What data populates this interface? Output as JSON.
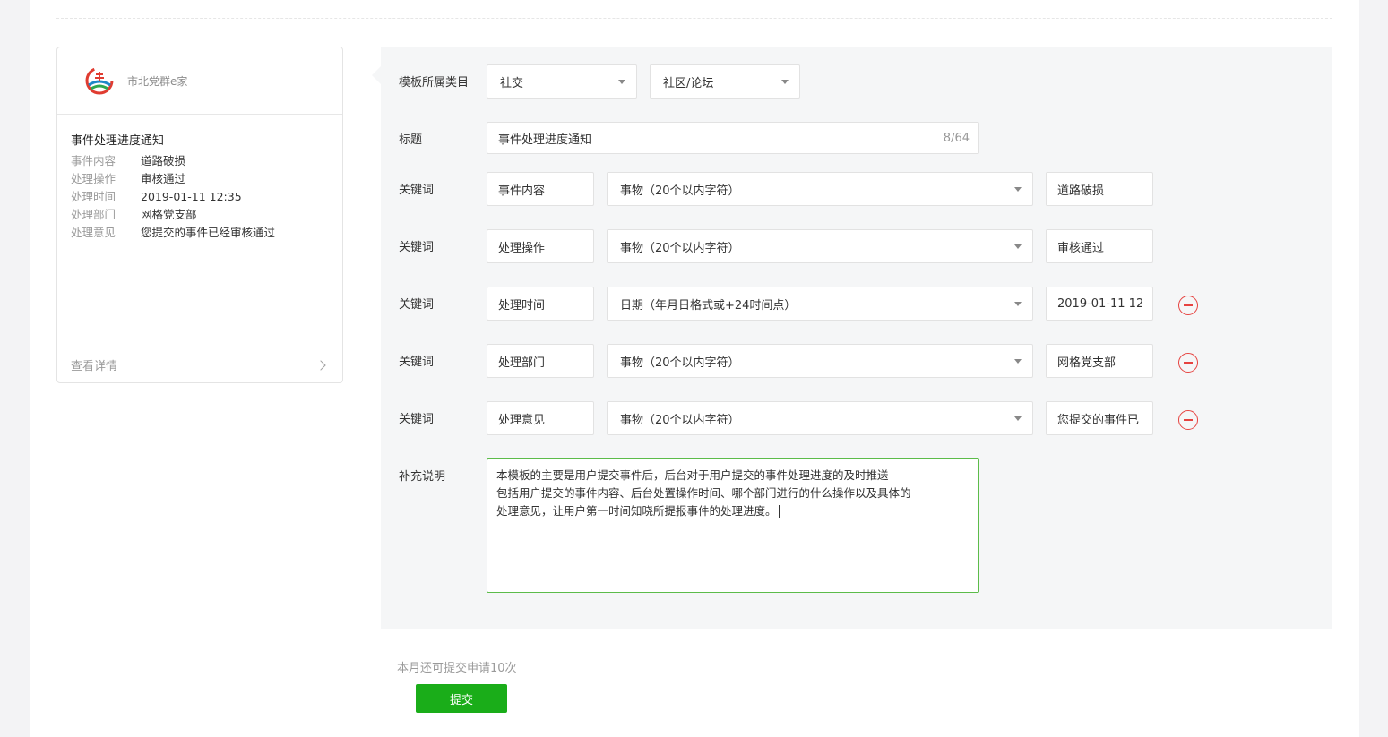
{
  "preview": {
    "account_name": "市北党群e家",
    "title": "事件处理进度通知",
    "rows": [
      {
        "key": "事件内容",
        "value": "道路破损"
      },
      {
        "key": "处理操作",
        "value": "审核通过"
      },
      {
        "key": "处理时间",
        "value": "2019-01-11 12:35"
      },
      {
        "key": "处理部门",
        "value": "网格党支部"
      },
      {
        "key": "处理意见",
        "value": "您提交的事件已经审核通过"
      }
    ],
    "detail_link": "查看详情"
  },
  "form": {
    "category_label": "模板所属类目",
    "category_primary": "社交",
    "category_secondary": "社区/论坛",
    "title_label": "标题",
    "title_value": "事件处理进度通知",
    "title_counter": "8/64",
    "keyword_label": "关键词",
    "keywords": [
      {
        "name": "事件内容",
        "type": "事物（20个以内字符）",
        "example": "道路破损",
        "removable": false
      },
      {
        "name": "处理操作",
        "type": "事物（20个以内字符）",
        "example": "审核通过",
        "removable": false
      },
      {
        "name": "处理时间",
        "type": "日期（年月日格式或+24时间点）",
        "example": "2019-01-11 12",
        "removable": true
      },
      {
        "name": "处理部门",
        "type": "事物（20个以内字符）",
        "example": "网格党支部",
        "removable": true
      },
      {
        "name": "处理意见",
        "type": "事物（20个以内字符）",
        "example": "您提交的事件已",
        "removable": true
      }
    ],
    "note_label": "补充说明",
    "note_lines": [
      "本模板的主要是用户提交事件后，后台对于用户提交的事件处理进度的及时推送",
      "包括用户提交的事件内容、后台处置操作时间、哪个部门进行的什么操作以及具体的",
      "处理意见，让用户第一时间知晓所提报事件的处理进度。"
    ]
  },
  "footer": {
    "quota_text": "本月还可提交申请10次",
    "submit_label": "提交"
  },
  "colors": {
    "primary_green": "#1aad19",
    "danger_red": "#e64340",
    "focus_green": "#5cbc4a"
  }
}
